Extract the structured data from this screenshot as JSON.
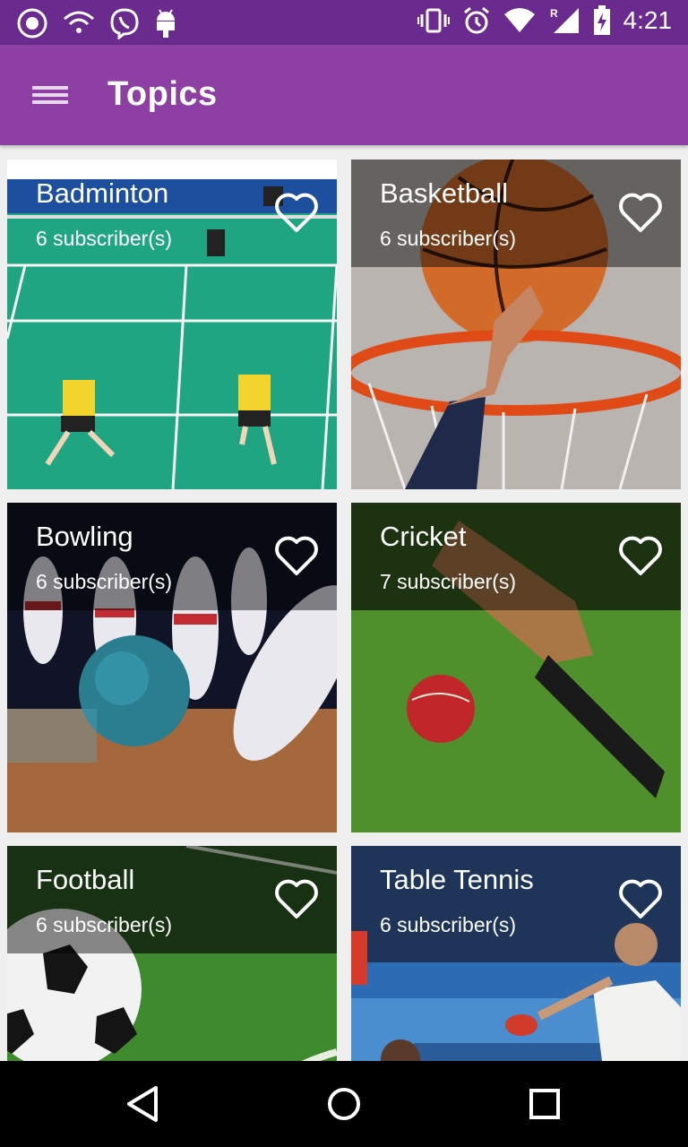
{
  "status_bar": {
    "time": "4:21",
    "icons": [
      "viber-outline-icon",
      "wifi-icon",
      "viber-icon",
      "android-icon",
      "vibrate-icon",
      "alarm-icon",
      "wifi-signal-icon",
      "cell-signal-roaming-icon",
      "battery-charging-icon"
    ]
  },
  "app_bar": {
    "title": "Topics",
    "menu_icon": "hamburger-menu-icon"
  },
  "topics": [
    {
      "name": "Badminton",
      "subscribers": "6 subscriber(s)"
    },
    {
      "name": "Basketball",
      "subscribers": "6 subscriber(s)"
    },
    {
      "name": "Bowling",
      "subscribers": "6 subscriber(s)"
    },
    {
      "name": "Cricket",
      "subscribers": "7 subscriber(s)"
    },
    {
      "name": "Football",
      "subscribers": "6 subscriber(s)"
    },
    {
      "name": "Table Tennis",
      "subscribers": "6 subscriber(s)"
    }
  ],
  "nav_bar": {
    "icons": [
      "back-icon",
      "home-icon",
      "recents-icon"
    ]
  },
  "colors": {
    "status_bar": "#6a2a8e",
    "app_bar": "#8e3fa3",
    "background": "#efefef"
  }
}
